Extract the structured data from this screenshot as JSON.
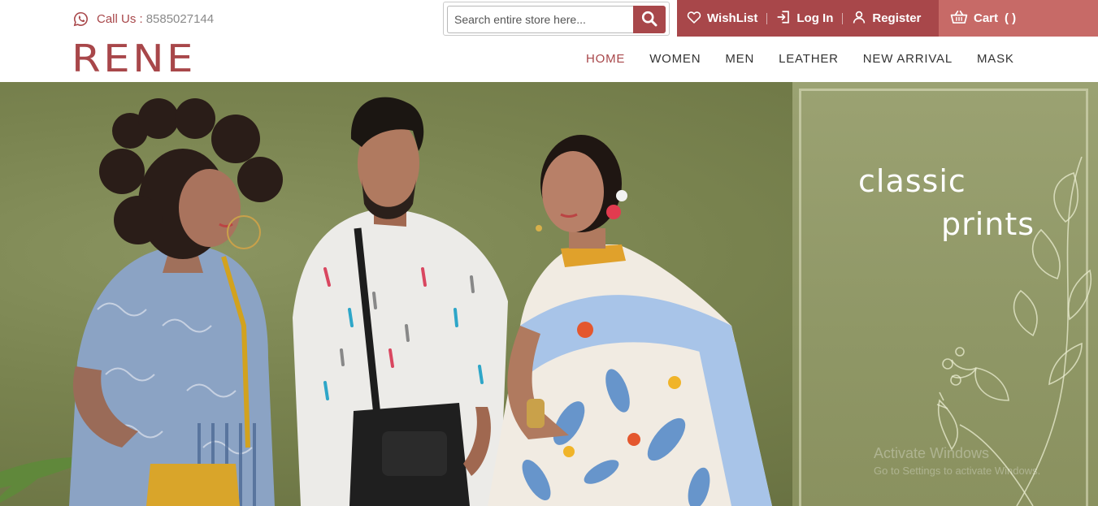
{
  "header": {
    "call_label": "Call Us :",
    "call_number": "8585027144",
    "whatsapp_icon": "whatsapp-icon"
  },
  "search": {
    "placeholder": "Search entire store here...",
    "icon": "search-icon"
  },
  "account": {
    "wishlist_label": "WishList",
    "login_label": "Log In",
    "register_label": "Register",
    "cart_label": "Cart",
    "cart_count": "( )"
  },
  "brand": {
    "logo_text": "RENE"
  },
  "nav": {
    "items": [
      {
        "label": "HOME",
        "active": true
      },
      {
        "label": "WOMEN",
        "active": false
      },
      {
        "label": "MEN",
        "active": false
      },
      {
        "label": "LEATHER",
        "active": false
      },
      {
        "label": "NEW ARRIVAL",
        "active": false
      },
      {
        "label": "MASK",
        "active": false
      }
    ]
  },
  "hero": {
    "tagline_line1": "classic",
    "tagline_line2": "prints"
  },
  "system_overlay": {
    "line1": "Activate Windows",
    "line2": "Go to Settings to activate Windows."
  },
  "colors": {
    "brand": "#a8474a",
    "cart_bg": "#c76a67",
    "hero_green": "#79834f"
  }
}
